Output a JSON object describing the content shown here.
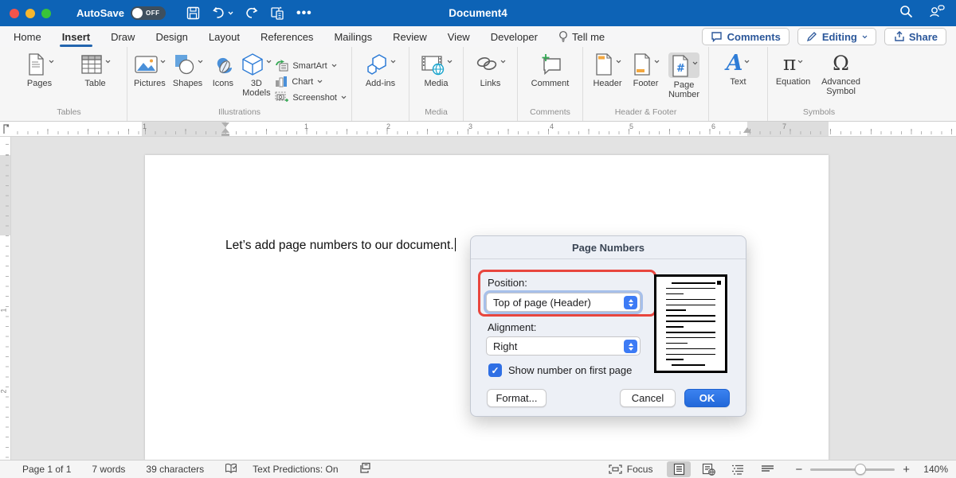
{
  "titlebar": {
    "autosave_label": "AutoSave",
    "autosave_state": "OFF",
    "title": "Document4"
  },
  "tabs": {
    "home": "Home",
    "insert": "Insert",
    "draw": "Draw",
    "design": "Design",
    "layout": "Layout",
    "references": "References",
    "mailings": "Mailings",
    "review": "Review",
    "view": "View",
    "developer": "Developer",
    "tell_me": "Tell me"
  },
  "top_actions": {
    "comments": "Comments",
    "editing": "Editing",
    "share": "Share"
  },
  "ribbon": {
    "pages": "Pages",
    "table": "Table",
    "pictures": "Pictures",
    "shapes": "Shapes",
    "icons": "Icons",
    "models_3d": "3D Models",
    "smartart": "SmartArt",
    "chart": "Chart",
    "screenshot": "Screenshot",
    "addins": "Add-ins",
    "media": "Media",
    "links": "Links",
    "comment": "Comment",
    "header": "Header",
    "footer": "Footer",
    "page_number": "Page Number",
    "text": "Text",
    "equation": "Equation",
    "advanced_symbol": "Advanced Symbol",
    "group_labels": {
      "tables": "Tables",
      "illustrations": "Illustrations",
      "media": "Media",
      "comments": "Comments",
      "header_footer": "Header & Footer",
      "symbols": "Symbols"
    }
  },
  "ruler": {
    "h_numbers": [
      "1",
      "1",
      "2",
      "3",
      "4",
      "5",
      "6",
      "7"
    ],
    "v_numbers": [
      "1",
      "2"
    ]
  },
  "document": {
    "text": "Let’s add page numbers to our document."
  },
  "dialog": {
    "title": "Page Numbers",
    "position_label": "Position:",
    "position_value": "Top of page (Header)",
    "alignment_label": "Alignment:",
    "alignment_value": "Right",
    "first_page_checkbox": "Show number on first page",
    "first_page_checked": true,
    "format_button": "Format...",
    "cancel_button": "Cancel",
    "ok_button": "OK",
    "highlight_color": "#e8463e",
    "accent_color": "#3d7bf5",
    "preview_lines": [
      [
        18,
        74
      ],
      [
        8,
        84
      ],
      [
        8,
        30
      ],
      [
        8,
        84
      ],
      [
        8,
        84
      ],
      [
        8,
        34
      ],
      [
        8,
        84
      ],
      [
        8,
        84
      ],
      [
        8,
        30
      ],
      [
        8,
        84
      ],
      [
        8,
        84
      ],
      [
        8,
        36
      ],
      [
        8,
        84
      ],
      [
        8,
        84
      ],
      [
        8,
        30
      ],
      [
        18,
        56
      ]
    ]
  },
  "statusbar": {
    "page_info": "Page 1 of 1",
    "word_count": "7 words",
    "char_count": "39 characters",
    "predictions": "Text Predictions: On",
    "focus_label": "Focus",
    "zoom_level": "140%"
  }
}
